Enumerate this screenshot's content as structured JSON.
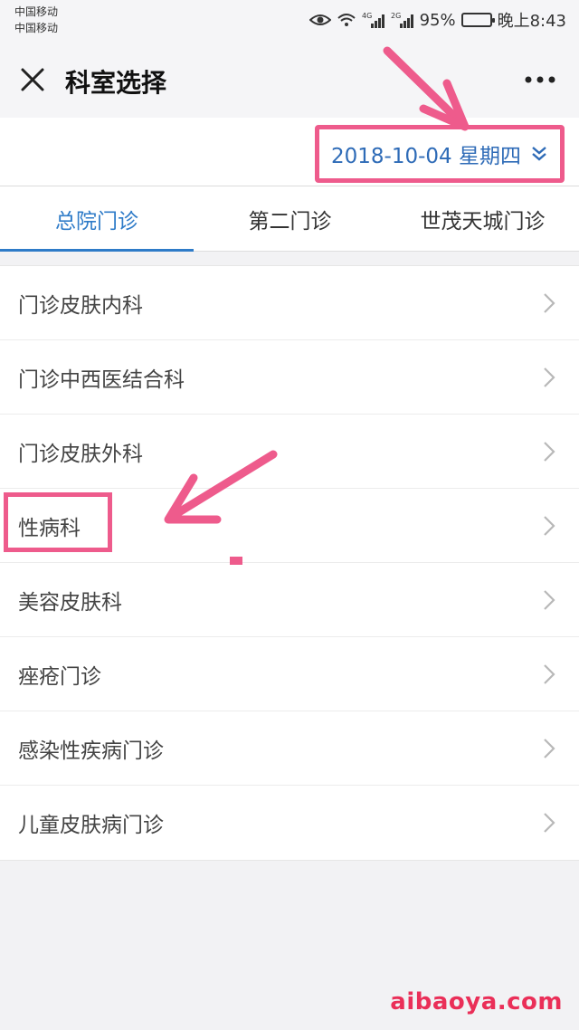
{
  "status_bar": {
    "carrier_1": "中国移动",
    "carrier_2": "中国移动",
    "network_1": "4G",
    "network_2": "2G",
    "battery": "95%",
    "battery_level": 0.95,
    "time": "晚上8:43"
  },
  "nav": {
    "title": "科室选择",
    "close_icon": "close-icon",
    "more_icon": "more-icon"
  },
  "date_selector": {
    "value": "2018-10-04 星期四",
    "icon": "double-chevron-down-icon"
  },
  "tabs": [
    {
      "label": "总院门诊",
      "active": true
    },
    {
      "label": "第二门诊",
      "active": false
    },
    {
      "label": "世茂天城门诊",
      "active": false
    }
  ],
  "departments": [
    {
      "label": "门诊皮肤内科"
    },
    {
      "label": "门诊中西医结合科"
    },
    {
      "label": "门诊皮肤外科"
    },
    {
      "label": "性病科"
    },
    {
      "label": "美容皮肤科"
    },
    {
      "label": "痤疮门诊"
    },
    {
      "label": "感染性疾病门诊"
    },
    {
      "label": "儿童皮肤病门诊"
    }
  ],
  "watermark": "aibaoya.com",
  "colors": {
    "accent_blue": "#2e7bc8",
    "highlight_pink": "#ee5b8c",
    "watermark_red": "#ea2f58"
  }
}
